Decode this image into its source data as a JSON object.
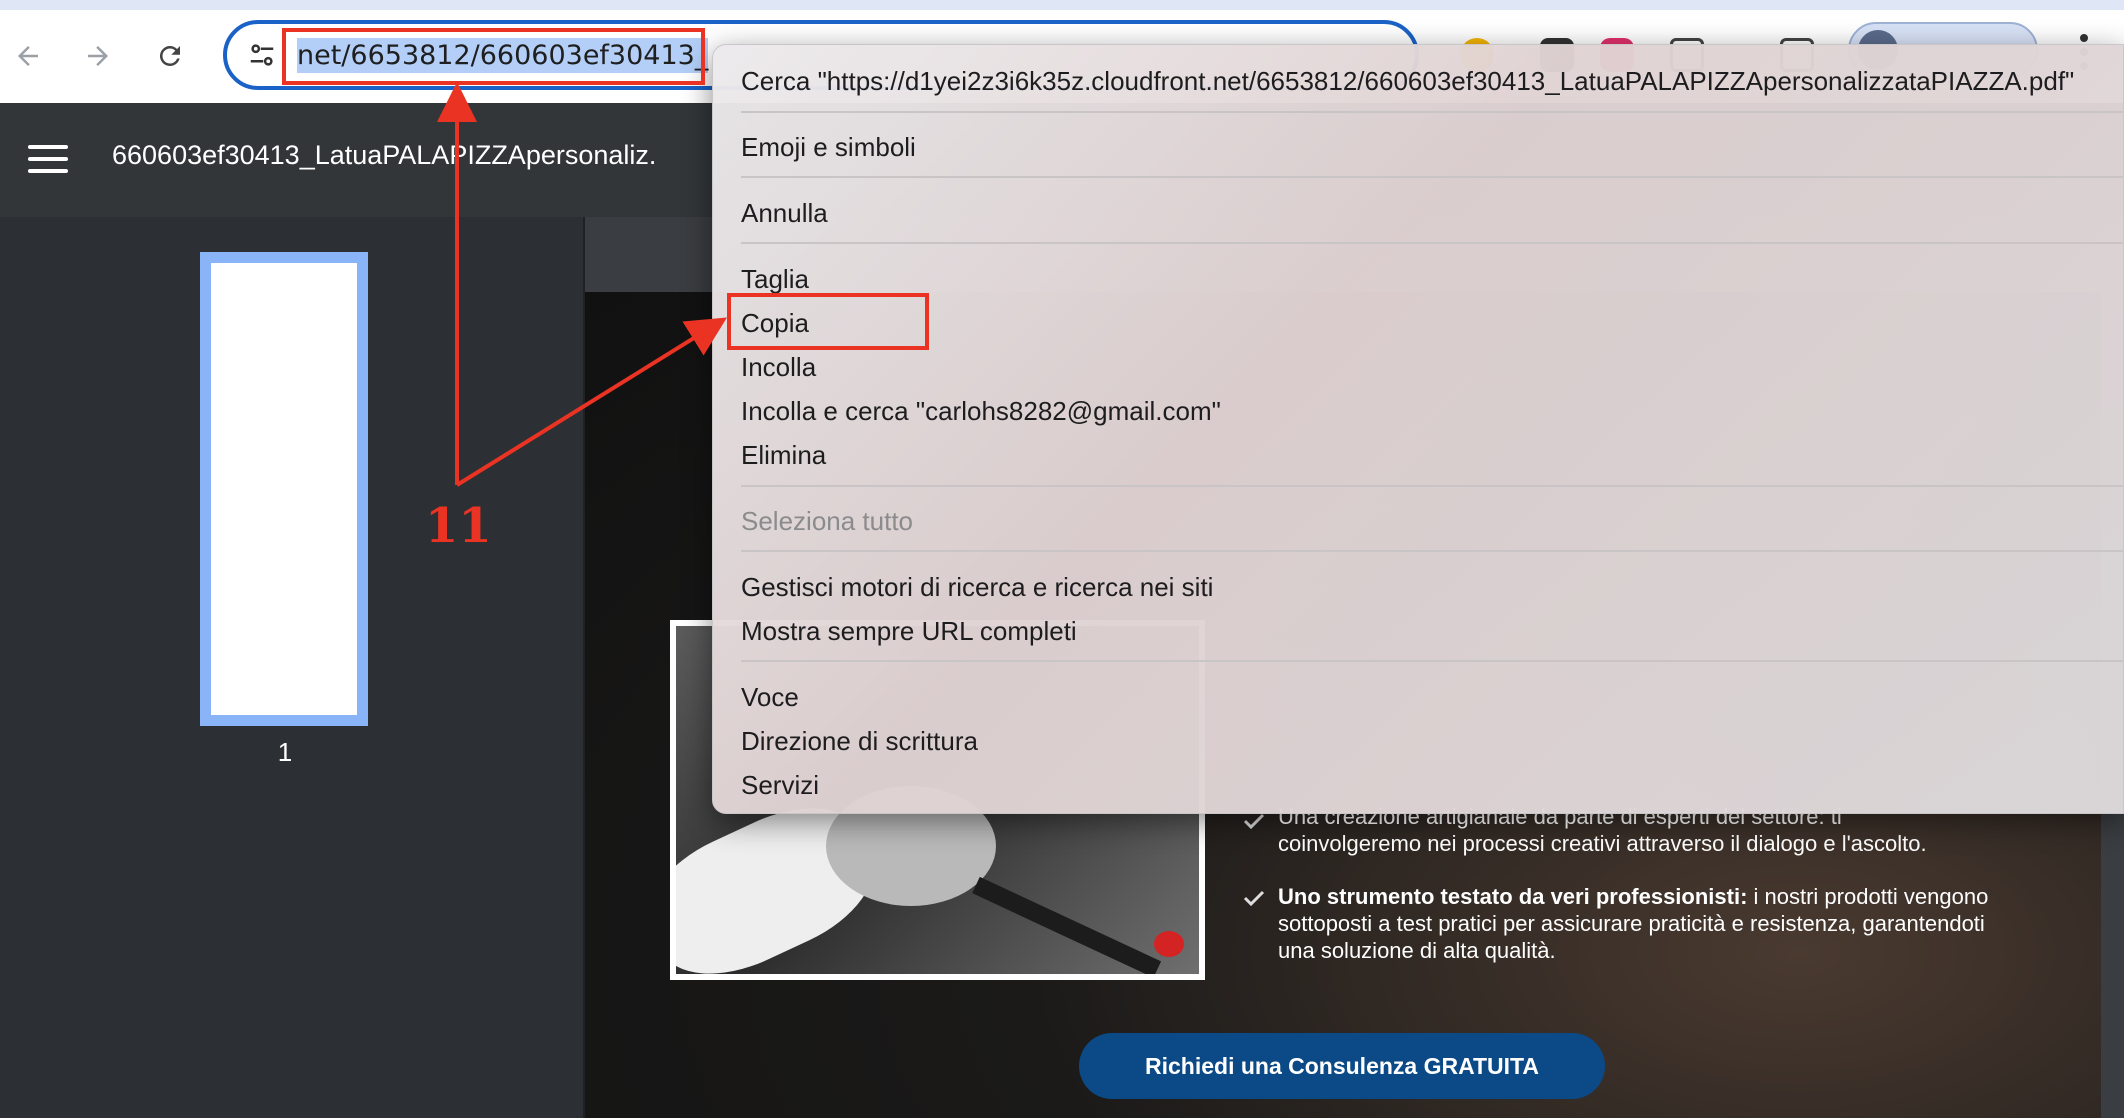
{
  "browser": {
    "url_display": "net/6653812/660603ef30413_",
    "icons": {
      "back": "arrow-left-icon",
      "forward": "arrow-right-icon",
      "reload": "reload-icon",
      "site_info": "tune-icon",
      "menu": "more-vertical-icon"
    }
  },
  "pdf": {
    "title": "660603ef30413_LatuaPALAPIZZApersonaliz.",
    "thumbnail_page": "1"
  },
  "document": {
    "features": [
      {
        "bold": "Una creazione artigianale da parte di esperti del settore:",
        "text": " ti coinvolgeremo nei processi creativi attraverso il dialogo e l'ascolto."
      },
      {
        "bold": "Uno strumento testato da veri professionisti:",
        "text": " i nostri prodotti vengono sottoposti a test pratici per assicurare praticità e resistenza, garantendoti una soluzione di alta qualità."
      }
    ],
    "feature_continuation": "coinvolgeremo nei processi creativi attraverso il dialogo e l'ascolto.",
    "cta_label": "Richiedi una Consulenza GRATUITA"
  },
  "context_menu": {
    "items": [
      {
        "label": "Cerca \"https://d1yei2z3i6k35z.cloudfront.net/6653812/660603ef30413_LatuaPALAPIZZApersonalizzataPIAZZA.pdf\"",
        "enabled": true
      },
      {
        "label": "Emoji e simboli",
        "enabled": true
      },
      {
        "label": "Annulla",
        "enabled": true
      },
      {
        "label": "Taglia",
        "enabled": true
      },
      {
        "label": "Copia",
        "enabled": true
      },
      {
        "label": "Incolla",
        "enabled": true
      },
      {
        "label": "Incolla e cerca \"carlohs8282@gmail.com\"",
        "enabled": true
      },
      {
        "label": "Elimina",
        "enabled": true
      },
      {
        "label": "Seleziona tutto",
        "enabled": false
      },
      {
        "label": "Gestisci motori di ricerca e ricerca nei siti",
        "enabled": true
      },
      {
        "label": "Mostra sempre URL completi",
        "enabled": true
      },
      {
        "label": "Voce",
        "enabled": true
      },
      {
        "label": "Direzione di scrittura",
        "enabled": true
      },
      {
        "label": "Servizi",
        "enabled": true
      }
    ]
  },
  "annotation": {
    "step_label": "11",
    "color": "#ea3323"
  }
}
